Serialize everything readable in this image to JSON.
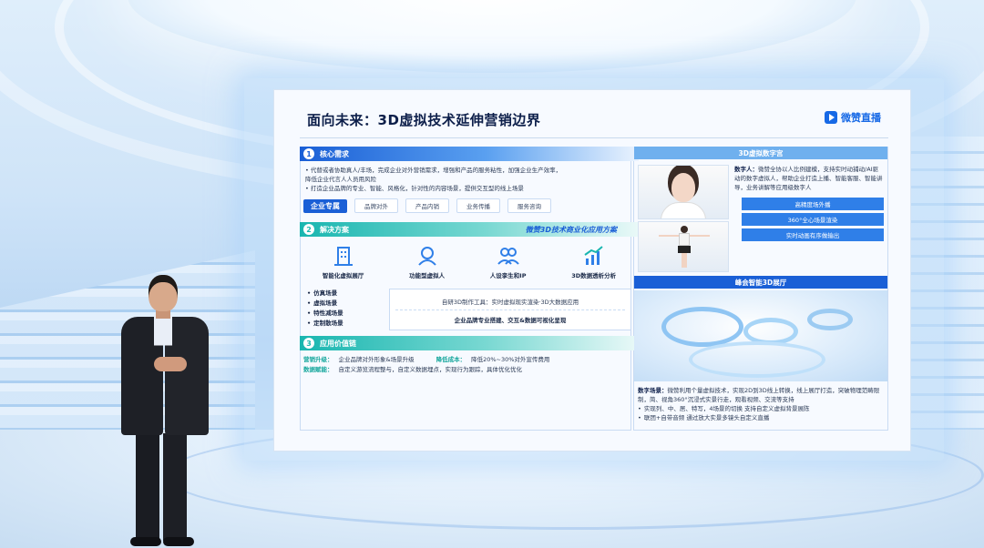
{
  "slide": {
    "title": "面向未来：3D虚拟技术延伸营销边界",
    "logo_text": "微赞直播"
  },
  "left": {
    "section1": {
      "num": "1",
      "title": "核心需求",
      "bullets": [
        "• 代替或者协助真人/丰场，完成企业对外营销需求，增强和产品的服务粘性，加强企业生产效率，",
        "  降低企业代言人人员用风险",
        "• 打造企业品牌的专业、智能、风格化，针对性的内容场景，提供交互型的线上场景"
      ],
      "tag_main": "企业专属",
      "tags": [
        "品牌对外",
        "产品内销",
        "业务传播",
        "服务咨询"
      ]
    },
    "section2": {
      "num": "2",
      "title": "解决方案",
      "right_title": "微赞3D技术商业化应用方案",
      "icons": [
        {
          "label": "智能化虚拟展厅"
        },
        {
          "label": "功能型虚拟人"
        },
        {
          "label": "人设孪生和IP"
        },
        {
          "label": "3D数据透析分析"
        }
      ],
      "scenes": [
        "仿真场景",
        "虚拟场景",
        "特性减场景",
        "定制散场景"
      ],
      "box_line1": "自研3D制作工具：实时虚拟现实渲染·3D大数据应用",
      "box_line2": "企业品牌专业搭建、交互&数据可视化呈现"
    },
    "section3": {
      "num": "3",
      "title": "应用价值链",
      "rows": [
        {
          "k1": "营销升级：",
          "v1": "企业品牌对外形象&场景升级",
          "k2": "降低成本：",
          "v2": "降低20%~30%对外宣传费用"
        },
        {
          "k1": "数据赋能：",
          "v1": "自定义游览流程整与，自定义数据埋点，实现行为跟踪，具体优化优化",
          "k2": "",
          "v2": ""
        }
      ]
    }
  },
  "right": {
    "avatar_head": "3D虚拟数字宫",
    "avatar_desc_key": "数字人：",
    "avatar_desc": "微赞全协以人比例建模，支持实时动捕动/AI驱动的数字虚拟人，帮助企业打造上播、智能客服、智能讲导，业务讲解等应用级数字人",
    "features": [
      "高精度场外播",
      "360°全心场景渲染",
      "实时动画有序做输出"
    ],
    "hall_head": "峰会智能3D展厅",
    "hall_desc_key": "数字场景：",
    "hall_desc": "微赞利用个量虚拟技术，实现2D到3D线上转换，线上展厅打造，突破物理范畴限制，简、视角360°沉浸式实景行走，观看视频、交流等支持",
    "hall_bullets": [
      "实现列、中、居、特写，4场景的切换 支持自定义虚拟背景展陈",
      "联团+自带音频 通过放大实景多镜头自定义直播"
    ]
  },
  "colors": {
    "primary_blue": "#1a5fd6",
    "teal": "#19b6b0",
    "title_navy": "#0d1f4a"
  }
}
